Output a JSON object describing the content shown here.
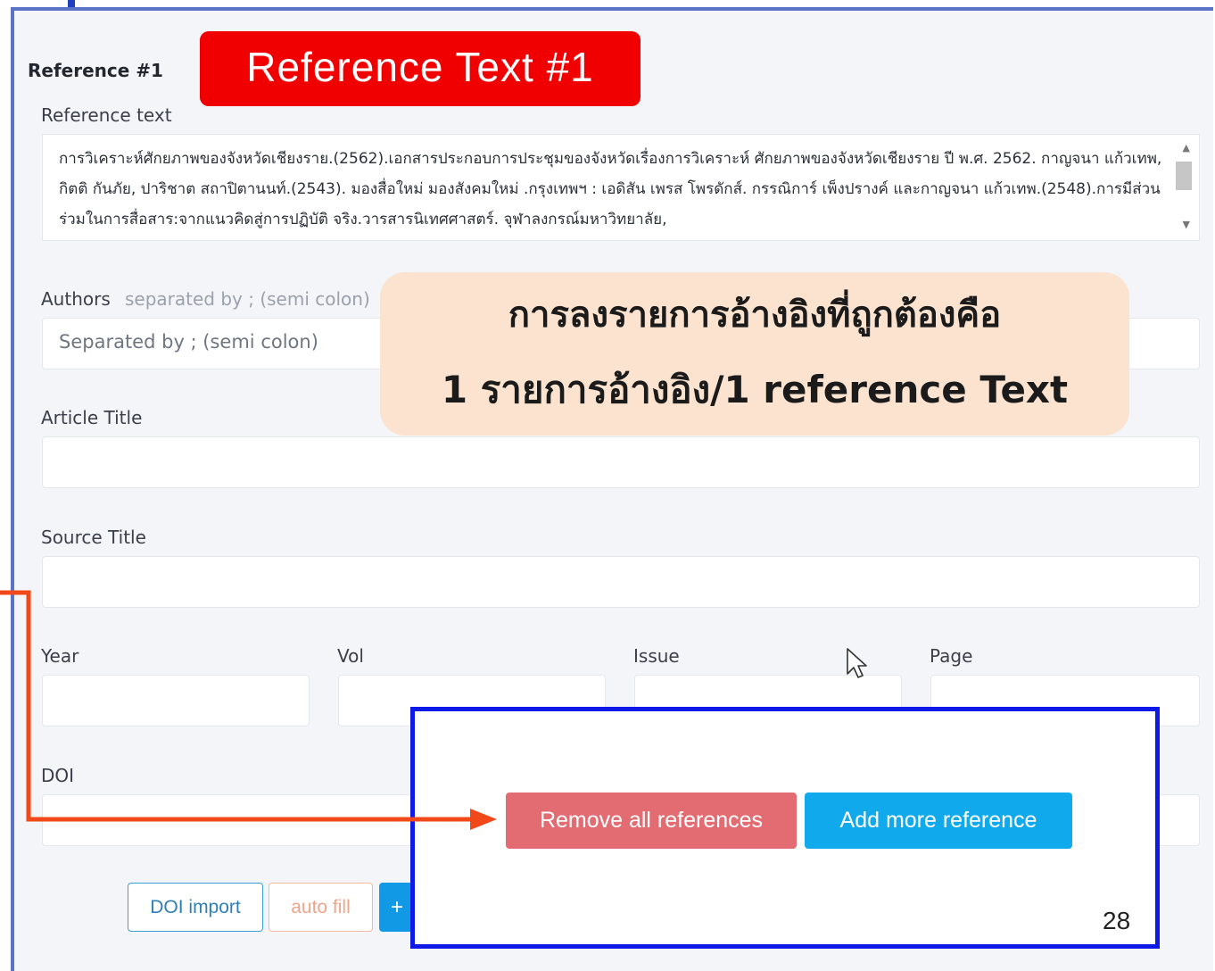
{
  "form": {
    "reference_heading": "Reference #1",
    "reference_text_label": "Reference text",
    "reference_text_value": "การวิเคราะห์ศักยภาพของจังหวัดเชียงราย.(2562).เอกสารประกอบการประชุมของจังหวัดเรื่องการวิเคราะห์ ศักยภาพของจังหวัดเชียงราย ปี พ.ศ. 2562. กาญจนา แก้วเทพ, กิตติ กันภัย, ปาริชาต สถาปิตานนท์.(2543). มองสื่อใหม่ มองสังคมใหม่ .กรุงเทพฯ : เอดิสัน เพรส โพรดักส์. กรรณิการ์ เพ็งปรางค์ และกาญจนา แก้วเทพ.(2548).การมีส่วนร่วมในการสื่อสาร:จากแนวคิดสู่การปฏิบัติ จริง.วารสารนิเทศศาสตร์. จุฬาลงกรณ์มหาวิทยาลัย,",
    "authors_label": "Authors",
    "authors_hint": "separated by ; (semi colon)",
    "authors_placeholder": "Separated by ; (semi colon)",
    "article_title_label": "Article Title",
    "source_title_label": "Source Title",
    "year_label": "Year",
    "vol_label": "Vol",
    "issue_label": "Issue",
    "page_label": "Page",
    "doi_label": "DOI"
  },
  "buttons": {
    "doi_import": "DOI import",
    "auto_fill": "auto fill",
    "plus": "+",
    "remove_all": "Remove all references",
    "add_more": "Add more reference"
  },
  "annotations": {
    "red_callout": "Reference Text #1",
    "peach_line1": "การลงรายการอ้างอิงที่ถูกต้องคือ",
    "peach_line2": "1 รายการอ้างอิง/1 reference Text",
    "page_number": "28"
  },
  "colors": {
    "frame_border": "#5b73c7",
    "red_callout": "#f00000",
    "peach_callout": "#fbe3cf",
    "blue_box": "#0d19e6",
    "arrow": "#f04818",
    "remove_button": "#e36b72",
    "add_button": "#10a9ec"
  },
  "icons": [
    "cursor-icon",
    "scroll-up-icon",
    "scroll-down-icon",
    "arrow-connector"
  ]
}
